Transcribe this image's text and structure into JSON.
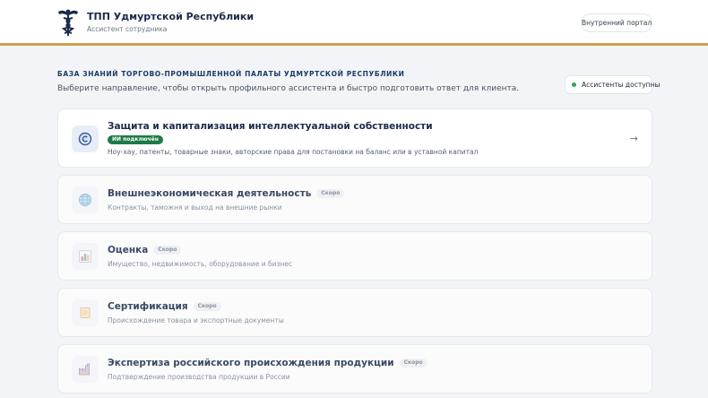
{
  "header": {
    "title": "ТПП Удмуртской Республики",
    "subtitle": "Ассистент сотрудника",
    "portal_button": "Внутренний портал",
    "logo_icon": "hermes-caduceus-logo"
  },
  "intro": {
    "label": "БАЗА ЗНАНИЙ ТОРГОВО-ПРОМЫШЛЕННОЙ ПАЛАТЫ УДМУРТСКОЙ РЕСПУБЛИКИ",
    "description": "Выберите направление, чтобы открыть профильного ассистента и быстро подготовить ответ для клиента.",
    "status": "Ассистенты доступны",
    "status_color": "#2aa852"
  },
  "cards": [
    {
      "title": "Защита и капитализация интеллектуальной собственности",
      "badge": "ИИ подключён",
      "description": "Ноу-хау, патенты, товарные знаки, авторские права для постановки на баланс или в уставной капитал",
      "icon": "copyright-icon",
      "arrow": "→"
    },
    {
      "title": "Внешнеэкономическая деятельность",
      "badge": "Скоро",
      "description": "Контракты, таможня и выход на внешние рынки",
      "icon": "globe-icon"
    },
    {
      "title": "Оценка",
      "badge": "Скоро",
      "description": "Имущество, недвижимость, оборудование и бизнес",
      "icon": "bar-chart-icon"
    },
    {
      "title": "Сертификация",
      "badge": "Скоро",
      "description": "Происхождение товара и экспортные документы",
      "icon": "scroll-icon"
    },
    {
      "title": "Экспертиза российского происхождения продукции",
      "badge": "Скоро",
      "description": "Подтверждение производства продукции в России",
      "icon": "factory-icon"
    }
  ],
  "colors": {
    "accent_gold": "#c9a24b",
    "navy": "#1b2b4b",
    "live_badge": "#1e7a46"
  }
}
